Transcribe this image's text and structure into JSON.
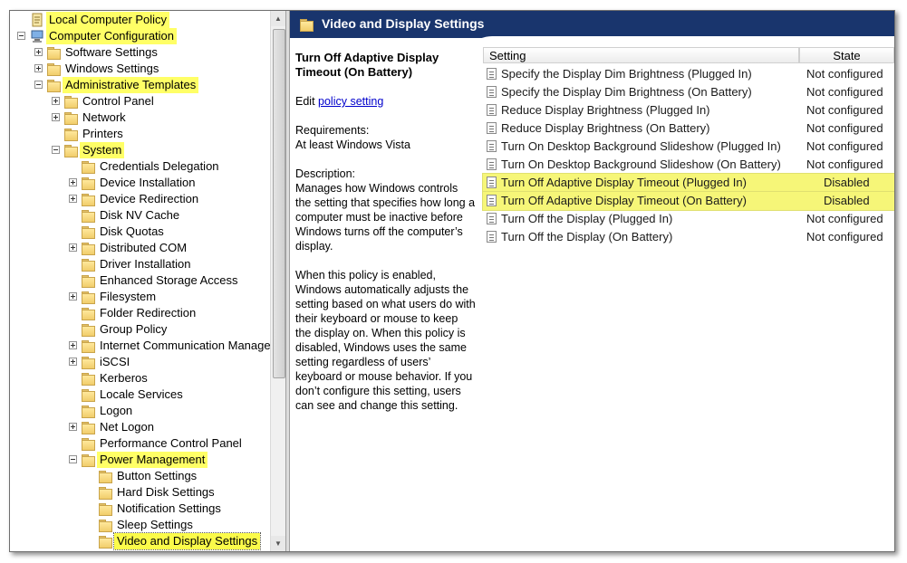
{
  "tree": {
    "items": [
      {
        "label": "Local Computer Policy",
        "indent": 0,
        "expander": "none",
        "icon": "policy-icon",
        "highlight": true
      },
      {
        "label": "Computer Configuration",
        "indent": 0,
        "expander": "minus",
        "icon": "computer-icon",
        "highlight": true
      },
      {
        "label": "Software Settings",
        "indent": 1,
        "expander": "plus",
        "icon": "folder-icon",
        "highlight": false
      },
      {
        "label": "Windows Settings",
        "indent": 1,
        "expander": "plus",
        "icon": "folder-icon",
        "highlight": false
      },
      {
        "label": "Administrative Templates",
        "indent": 1,
        "expander": "minus",
        "icon": "folder-icon",
        "highlight": true
      },
      {
        "label": "Control Panel",
        "indent": 2,
        "expander": "plus",
        "icon": "folder-icon",
        "highlight": false
      },
      {
        "label": "Network",
        "indent": 2,
        "expander": "plus",
        "icon": "folder-icon",
        "highlight": false
      },
      {
        "label": "Printers",
        "indent": 2,
        "expander": "none",
        "icon": "folder-icon",
        "highlight": false
      },
      {
        "label": "System",
        "indent": 2,
        "expander": "minus",
        "icon": "folder-icon",
        "highlight": true
      },
      {
        "label": "Credentials Delegation",
        "indent": 3,
        "expander": "none",
        "icon": "folder-icon",
        "highlight": false
      },
      {
        "label": "Device Installation",
        "indent": 3,
        "expander": "plus",
        "icon": "folder-icon",
        "highlight": false
      },
      {
        "label": "Device Redirection",
        "indent": 3,
        "expander": "plus",
        "icon": "folder-icon",
        "highlight": false
      },
      {
        "label": "Disk NV Cache",
        "indent": 3,
        "expander": "none",
        "icon": "folder-icon",
        "highlight": false
      },
      {
        "label": "Disk Quotas",
        "indent": 3,
        "expander": "none",
        "icon": "folder-icon",
        "highlight": false
      },
      {
        "label": "Distributed COM",
        "indent": 3,
        "expander": "plus",
        "icon": "folder-icon",
        "highlight": false
      },
      {
        "label": "Driver Installation",
        "indent": 3,
        "expander": "none",
        "icon": "folder-icon",
        "highlight": false
      },
      {
        "label": "Enhanced Storage Access",
        "indent": 3,
        "expander": "none",
        "icon": "folder-icon",
        "highlight": false
      },
      {
        "label": "Filesystem",
        "indent": 3,
        "expander": "plus",
        "icon": "folder-icon",
        "highlight": false
      },
      {
        "label": "Folder Redirection",
        "indent": 3,
        "expander": "none",
        "icon": "folder-icon",
        "highlight": false
      },
      {
        "label": "Group Policy",
        "indent": 3,
        "expander": "none",
        "icon": "folder-icon",
        "highlight": false
      },
      {
        "label": "Internet Communication Manage",
        "indent": 3,
        "expander": "plus",
        "icon": "folder-icon",
        "highlight": false
      },
      {
        "label": "iSCSI",
        "indent": 3,
        "expander": "plus",
        "icon": "folder-icon",
        "highlight": false
      },
      {
        "label": "Kerberos",
        "indent": 3,
        "expander": "none",
        "icon": "folder-icon",
        "highlight": false
      },
      {
        "label": "Locale Services",
        "indent": 3,
        "expander": "none",
        "icon": "folder-icon",
        "highlight": false
      },
      {
        "label": "Logon",
        "indent": 3,
        "expander": "none",
        "icon": "folder-icon",
        "highlight": false
      },
      {
        "label": "Net Logon",
        "indent": 3,
        "expander": "plus",
        "icon": "folder-icon",
        "highlight": false
      },
      {
        "label": "Performance Control Panel",
        "indent": 3,
        "expander": "none",
        "icon": "folder-icon",
        "highlight": false
      },
      {
        "label": "Power Management",
        "indent": 3,
        "expander": "minus",
        "icon": "folder-icon",
        "highlight": true
      },
      {
        "label": "Button Settings",
        "indent": 4,
        "expander": "none",
        "icon": "folder-icon",
        "highlight": false
      },
      {
        "label": "Hard Disk Settings",
        "indent": 4,
        "expander": "none",
        "icon": "folder-icon",
        "highlight": false
      },
      {
        "label": "Notification Settings",
        "indent": 4,
        "expander": "none",
        "icon": "folder-icon",
        "highlight": false
      },
      {
        "label": "Sleep Settings",
        "indent": 4,
        "expander": "none",
        "icon": "folder-icon",
        "highlight": false
      },
      {
        "label": "Video and Display Settings",
        "indent": 4,
        "expander": "none",
        "icon": "folder-icon",
        "highlight": true,
        "selected": true
      }
    ]
  },
  "pane": {
    "title": "Video and Display Settings",
    "header_color": "#19356d",
    "highlight_color": "#ffff66"
  },
  "description": {
    "policy_title": "Turn Off Adaptive Display Timeout (On Battery)",
    "edit_prefix": "Edit ",
    "edit_link": "policy setting ",
    "requirements_label": "Requirements:",
    "requirements_value": "At least Windows Vista",
    "description_label": "Description:",
    "paragraph1": "Manages how Windows controls the setting that specifies how long a computer must be inactive before Windows turns off the computer’s display.",
    "paragraph2": "When this policy is enabled, Windows automatically adjusts the setting based on what users do with their keyboard or mouse to keep the display on. When this policy is disabled, Windows uses the same setting regardless of users’ keyboard or mouse behavior. If you don’t configure this setting, users can see and change this setting."
  },
  "table": {
    "col_setting": "Setting",
    "col_state": "State",
    "rows": [
      {
        "name": "Specify the Display Dim Brightness (Plugged In)",
        "state": "Not configured",
        "highlight": false
      },
      {
        "name": "Specify the Display Dim Brightness (On Battery)",
        "state": "Not configured",
        "highlight": false
      },
      {
        "name": "Reduce Display Brightness (Plugged In)",
        "state": "Not configured",
        "highlight": false
      },
      {
        "name": "Reduce Display Brightness (On Battery)",
        "state": "Not configured",
        "highlight": false
      },
      {
        "name": "Turn On Desktop Background Slideshow (Plugged In)",
        "state": "Not configured",
        "highlight": false
      },
      {
        "name": "Turn On Desktop Background Slideshow (On Battery)",
        "state": "Not configured",
        "highlight": false
      },
      {
        "name": "Turn Off Adaptive Display Timeout (Plugged In)",
        "state": "Disabled",
        "highlight": true
      },
      {
        "name": "Turn Off Adaptive Display Timeout (On Battery)",
        "state": "Disabled",
        "highlight": true
      },
      {
        "name": "Turn Off the Display (Plugged In)",
        "state": "Not configured",
        "highlight": false
      },
      {
        "name": "Turn Off the Display (On Battery)",
        "state": "Not configured",
        "highlight": false
      }
    ]
  }
}
